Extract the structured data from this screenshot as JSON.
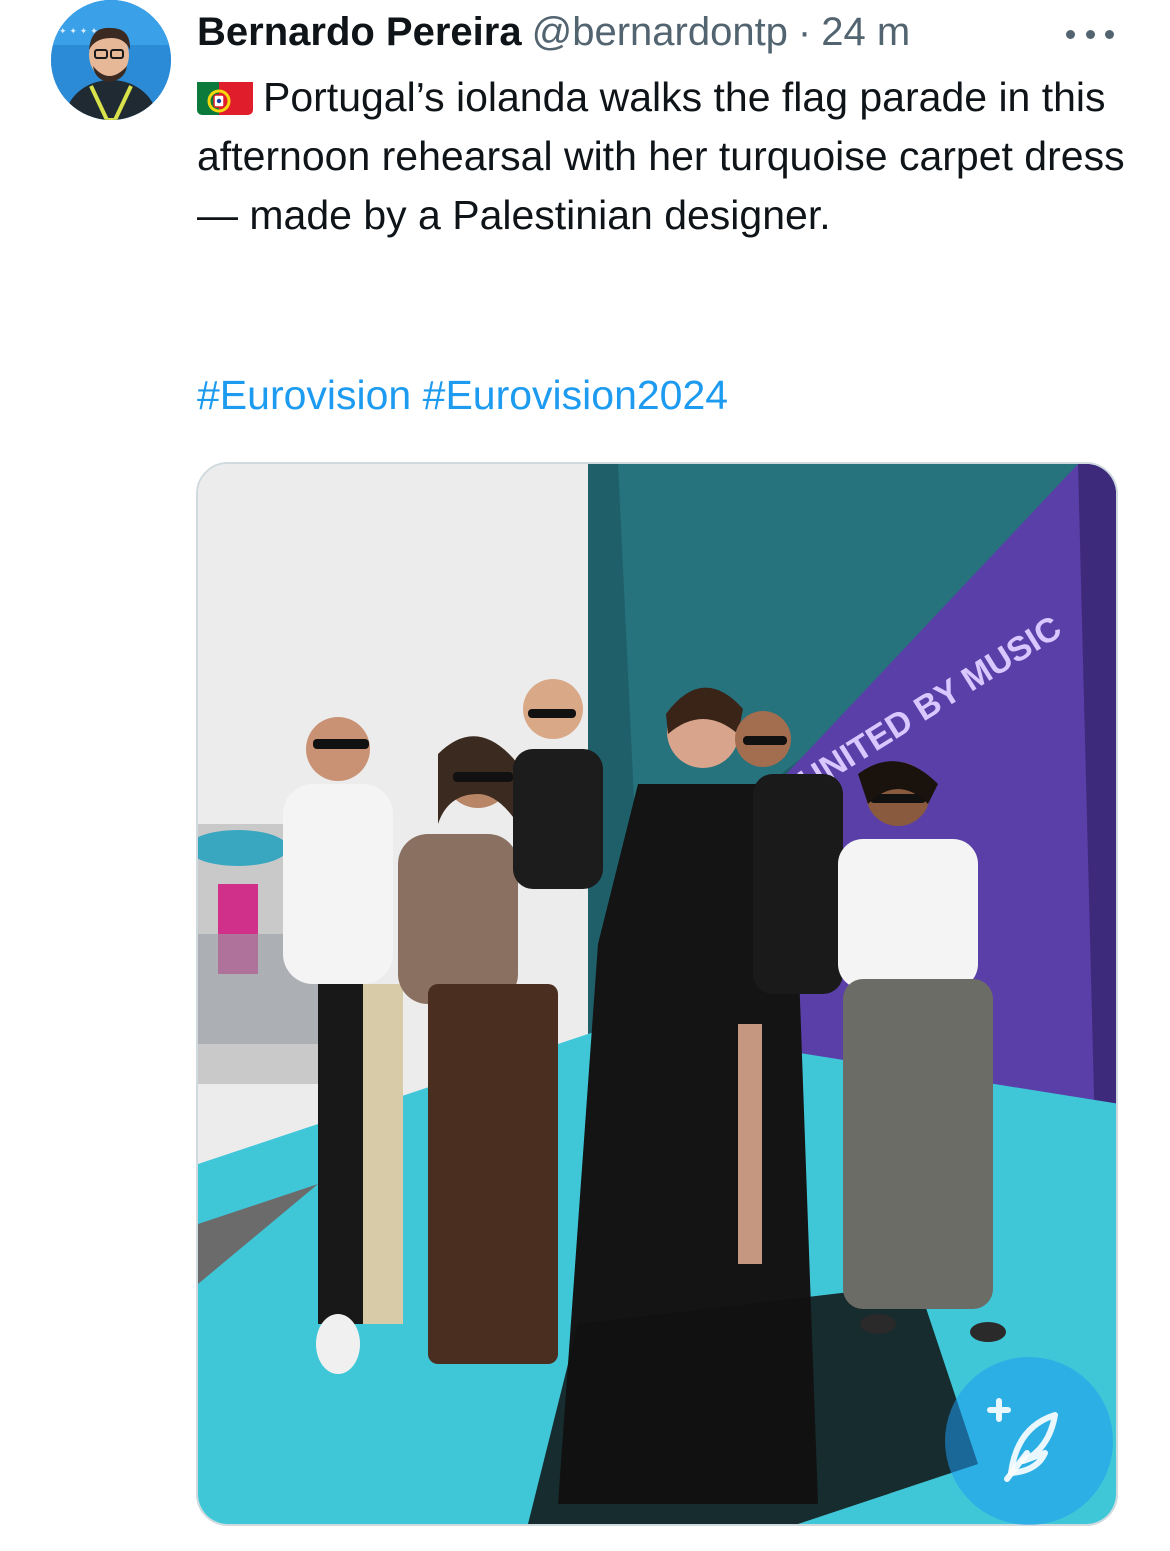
{
  "author": {
    "name": "Bernardo Pereira",
    "handle": "@bernardontp",
    "separator": "·",
    "timestamp": "24 m"
  },
  "tweet": {
    "flag_icon": "portugal-flag-emoji",
    "text": "Portugal’s iolanda walks the flag parade in this afternoon rehearsal with her turquoise carpet dress — made by a Palestinian designer.",
    "hashtags": [
      "#Eurovision",
      "#Eurovision2024"
    ]
  },
  "media": {
    "backdrop_text": "UNITED BY MUSIC"
  },
  "compose_button": {
    "icon": "feather-plus-icon"
  },
  "colors": {
    "link": "#1d9bf0",
    "secondary_text": "#536471",
    "carpet": "#3fc7d8",
    "backdrop": "#5a3fa8",
    "fab": "#1d9bf0"
  }
}
